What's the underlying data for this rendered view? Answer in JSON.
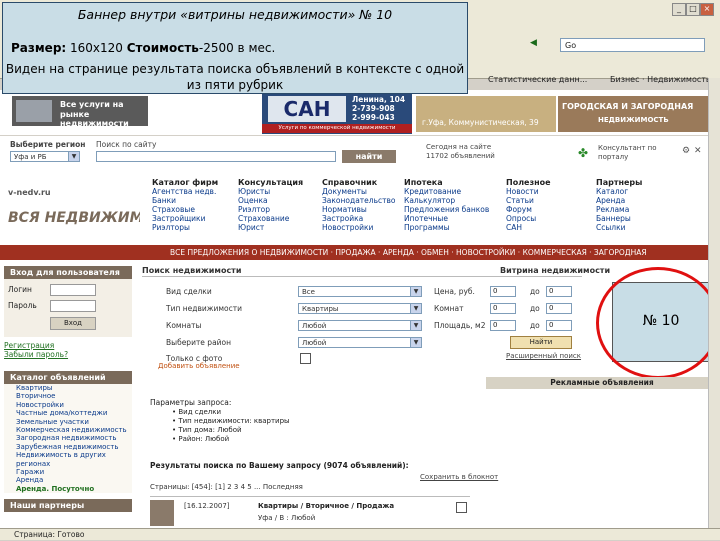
{
  "callout": {
    "title": "Баннер внутри «витрины недвижимости» № 10",
    "size_label": "Размер:",
    "size_value": " 160х120 ",
    "cost_label": "Стоимость",
    "cost_value": "-2500 в мес.",
    "description": "Виден на странице результата поиска объявлений в контексте с одной из пяти рубрик"
  },
  "browser": {
    "address": "Go",
    "links_item1": "Статистические данн...",
    "links_item2": "Бизнес · Недвижимость"
  },
  "banners": {
    "top_left_line1": "Все услуги на",
    "top_left_line2": "рынке недвижимости",
    "san_name": "САН",
    "san_address": "Ленина, 104",
    "san_phone1": "2-739-908",
    "san_phone2": "2-999-043",
    "san_subtitle": "Услуги по коммерческой недвижимости",
    "right_text1": "г.Уфа, Коммунистическая, 39",
    "right_text2": "ГОРОДСКАЯ И ЗАГОРОДНАЯ",
    "right_text3": "НЕДВИЖИМОСТЬ"
  },
  "header": {
    "region_label": "Выберите регион",
    "region_value": "Уфа и РБ",
    "search_label": "Поиск по сайту",
    "search_button": "найти",
    "ads_count": "Сегодня на сайте 11702 объявлений",
    "consult_label": "Консультант по порталу",
    "logo_url": "v-nedv.ru",
    "logo_text": "ВСЯ НЕДВИЖИМОСТЬ"
  },
  "nav": [
    {
      "title": "Каталог фирм",
      "items": [
        "Агентства недв.",
        "Банки",
        "Страховые",
        "Застройщики",
        "Риэлторы"
      ]
    },
    {
      "title": "Консультация",
      "items": [
        "Юристы",
        "Оценка",
        "Риэлтор",
        "Страхование",
        "Юрист"
      ]
    },
    {
      "title": "Справочник",
      "items": [
        "Документы",
        "Законодательство",
        "Нормативы",
        "Застройка",
        "Новостройки"
      ]
    },
    {
      "title": "Ипотека",
      "items": [
        "Кредитование",
        "Калькулятор",
        "Предложения банков",
        "Ипотечные",
        "Программы"
      ]
    },
    {
      "title": "Полезное",
      "items": [
        "Новости",
        "Статьи",
        "Форум",
        "Опросы",
        "САН"
      ]
    },
    {
      "title": "Партнеры",
      "items": [
        "Каталог",
        "Аренда",
        "Реклама",
        "Баннеры",
        "Ссылки"
      ]
    }
  ],
  "redbar": "ВСЕ ПРЕДЛОЖЕНИЯ О НЕДВИЖИМОСТИ · ПРОДАЖА · АРЕНДА · ОБМЕН · НОВОСТРОЙКИ · КОММЕРЧЕСКАЯ · ЗАГОРОДНАЯ",
  "sidebar": {
    "login_title": "Вход для пользователя",
    "login_label": "Логин",
    "password_label": "Пароль",
    "login_button": "Вход",
    "register_link": "Регистрация",
    "forgot_link": "Забыли пароль?",
    "catalog_title": "Каталог объявлений",
    "catalog_items": [
      "Квартиры",
      "Вторичное",
      "Новостройки",
      "Частные дома/коттеджи",
      "Земельные участки",
      "Коммерческая недвижимость",
      "Загородная недвижимость",
      "Зарубежная недвижимость",
      "Недвижимость в других регионах",
      "Гаражи",
      "Аренда"
    ],
    "catalog_bold": "Аренда. Посуточно",
    "partners_title": "Наши партнеры"
  },
  "search": {
    "title": "Поиск недвижимости",
    "type_label": "Вид сделки",
    "type_value": "Все",
    "category_label": "Тип недвижимости",
    "category_value": "Квартиры",
    "rooms_label": "Комнаты",
    "rooms_value": "Любой",
    "district_label": "Выберите район",
    "district_value": "Любой",
    "photo_label": "Только с фото",
    "price_label": "Цена, руб.",
    "rooms2_label": "Комнат",
    "area_label": "Площадь, м2",
    "from": "0",
    "to_label": "до",
    "to": "0",
    "find_button": "Найти",
    "extended_link": "Расширенный поиск",
    "add_link": "Добавить объявление"
  },
  "showcase": {
    "title": "Витрина недвижимости",
    "banner_label": "№ 10",
    "ads_title": "Рекламные объявления"
  },
  "results": {
    "params_title": "Параметры запроса:",
    "params": [
      "Вид сделки",
      "Тип недвижимости: квартиры",
      "Тип дома: Любой",
      "Район: Любой"
    ],
    "results_title": "Результаты поиска по Вашему запросу (9074 объявлений):",
    "pages": "Страницы: [454]: [1] 2 3 4 5 ... Последняя",
    "save_link": "Сохранить в блокнот",
    "row_date": "[16.12.2007]",
    "row_text": "Квартиры / Вторичное / Продажа",
    "row_sub": "Уфа / В : Любой"
  },
  "statusbar": "Страница: Готово"
}
